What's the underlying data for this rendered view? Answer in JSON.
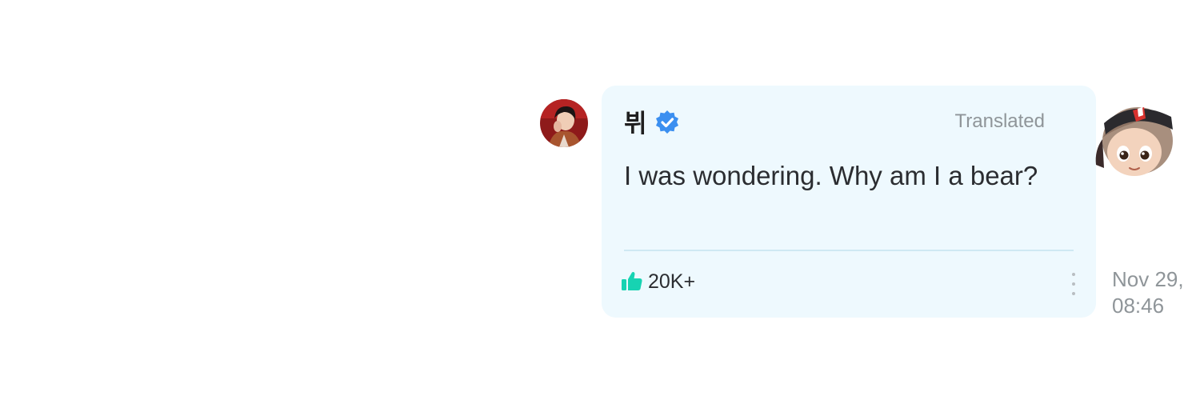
{
  "message": {
    "author": "뷔",
    "translated_label": "Translated",
    "text": "I was wondering. Why am I a bear?",
    "likes": "20K+",
    "timestamp": "Nov 29,\n08:46"
  },
  "icons": {
    "verified": "verified-check-badge-icon",
    "like": "thumbs-up-icon",
    "more": "vertical-ellipsis-icon"
  },
  "colors": {
    "bubble_background": "#eef9fe",
    "verified_blue": "#3b8ff0",
    "like_teal": "#17d3b2",
    "muted_text": "#8f9599"
  }
}
